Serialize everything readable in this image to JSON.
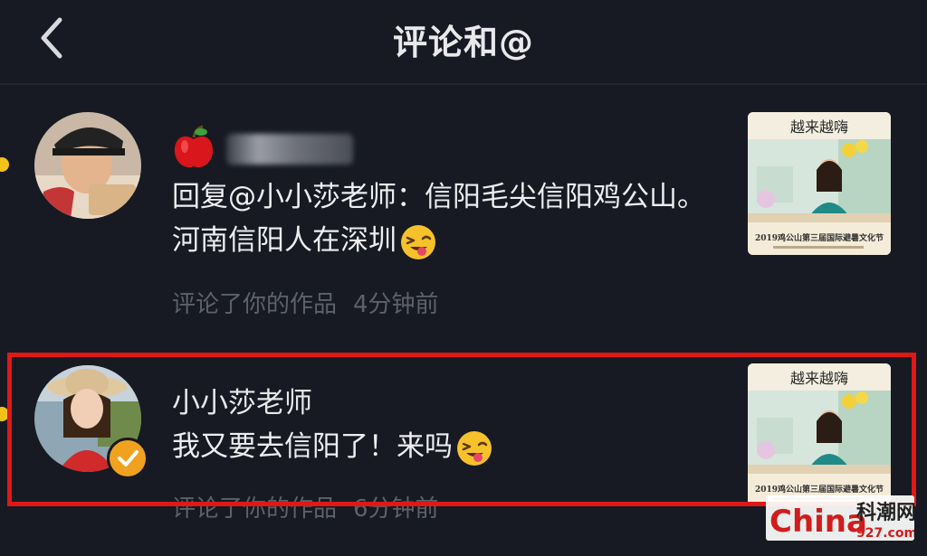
{
  "header": {
    "title": "评论和@"
  },
  "comments": [
    {
      "username": "",
      "text": "回复@小小莎老师：信阳毛尖信阳鸡公山。河南信阳人在深圳",
      "action": "评论了你的作品",
      "time": "4分钟前",
      "unread": true,
      "emoji": "wink-tongue-emoji"
    },
    {
      "username": "小小莎老师",
      "text": "我又要去信阳了！来吗",
      "action": "评论了你的作品",
      "time": "6分钟前",
      "unread": true,
      "verified": true,
      "emoji": "wink-tongue-emoji"
    }
  ],
  "thumbnail": {
    "top_banner": "越来越嗨",
    "caption": "2019鸡公山第三届国际避暑文化节"
  },
  "watermark": {
    "brand": "China",
    "cn": "科潮网",
    "domain": "927.com"
  },
  "colors": {
    "background": "#171a22",
    "unread_dot": "#f2c218",
    "verified_badge": "#f0a21f",
    "highlight": "#e01818"
  }
}
